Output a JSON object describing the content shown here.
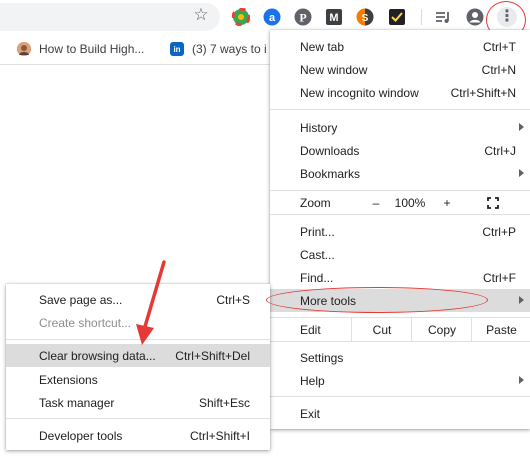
{
  "toolbar": {
    "star_icon": "star-icon",
    "extensions": [
      {
        "name": "globe-extension-icon",
        "glyph": "◍",
        "color": "#34a853"
      },
      {
        "name": "a-extension-icon",
        "glyph": "a",
        "color": "#1a73e8"
      },
      {
        "name": "pinterest-icon",
        "glyph": "P",
        "color": "#5f6368"
      },
      {
        "name": "m-extension-icon",
        "glyph": "M",
        "color": "#3c4043"
      },
      {
        "name": "s-extension-icon",
        "glyph": "S",
        "color": "#f57c00"
      },
      {
        "name": "checkmark-extension-icon",
        "glyph": "✓",
        "color": "#202124"
      },
      {
        "name": "media-controls-icon",
        "glyph": "≡",
        "color": "#5f6368"
      },
      {
        "name": "profile-avatar-icon",
        "glyph": "●",
        "color": "#5f6368"
      }
    ],
    "menu_icon": "⋮"
  },
  "bookmarks": [
    {
      "label": "How to Build High...",
      "icon": "person-favicon",
      "color": "#c77d4a"
    },
    {
      "label": "(3) 7 ways to i",
      "icon": "linkedin-favicon",
      "color": "#0a66c2",
      "glyph": "in"
    }
  ],
  "main_menu": {
    "new_tab": {
      "label": "New tab",
      "shortcut": "Ctrl+T"
    },
    "new_window": {
      "label": "New window",
      "shortcut": "Ctrl+N"
    },
    "new_incognito": {
      "label": "New incognito window",
      "shortcut": "Ctrl+Shift+N"
    },
    "history": {
      "label": "History"
    },
    "downloads": {
      "label": "Downloads",
      "shortcut": "Ctrl+J"
    },
    "bookmarks": {
      "label": "Bookmarks"
    },
    "zoom": {
      "label": "Zoom",
      "minus": "–",
      "value": "100%",
      "plus": "+"
    },
    "print": {
      "label": "Print...",
      "shortcut": "Ctrl+P"
    },
    "cast": {
      "label": "Cast..."
    },
    "find": {
      "label": "Find...",
      "shortcut": "Ctrl+F"
    },
    "more_tools": {
      "label": "More tools"
    },
    "edit": {
      "label": "Edit",
      "cut": "Cut",
      "copy": "Copy",
      "paste": "Paste"
    },
    "settings": {
      "label": "Settings"
    },
    "help": {
      "label": "Help"
    },
    "exit": {
      "label": "Exit"
    }
  },
  "sub_menu": {
    "save_page": {
      "label": "Save page as...",
      "shortcut": "Ctrl+S"
    },
    "create_shortcut": {
      "label": "Create shortcut..."
    },
    "clear_browsing": {
      "label": "Clear browsing data...",
      "shortcut": "Ctrl+Shift+Del"
    },
    "extensions": {
      "label": "Extensions"
    },
    "task_manager": {
      "label": "Task manager",
      "shortcut": "Shift+Esc"
    },
    "developer_tools": {
      "label": "Developer tools",
      "shortcut": "Ctrl+Shift+I"
    }
  },
  "colors": {
    "annotation": "#e53935",
    "highlight": "#dcdcdc"
  }
}
